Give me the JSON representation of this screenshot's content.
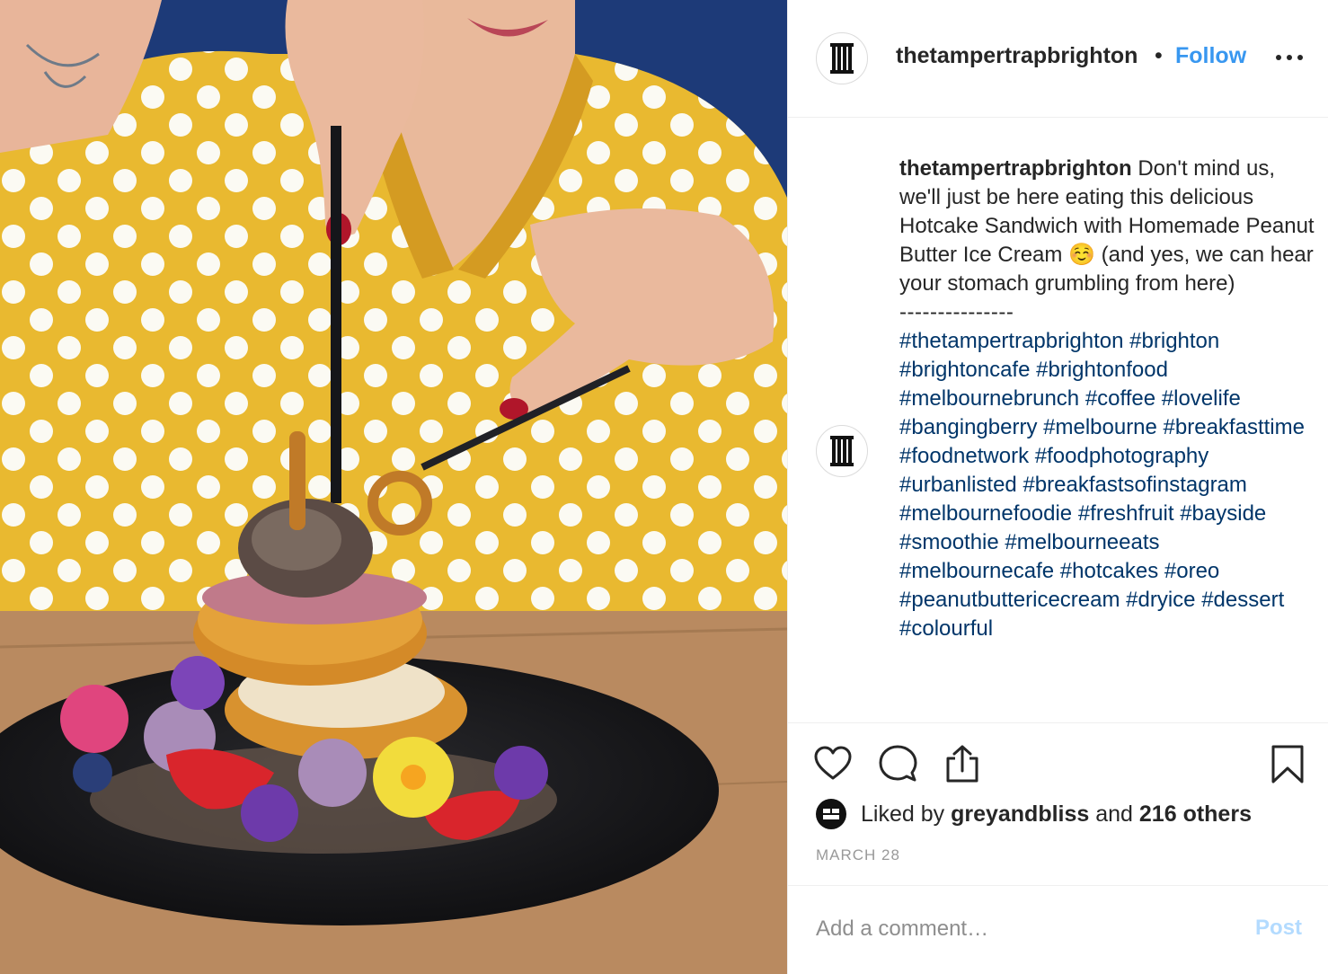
{
  "header": {
    "username": "thetampertrapbrighton",
    "dot": "•",
    "follow_label": "Follow",
    "more_icon": "ellipsis-icon"
  },
  "caption": {
    "username": "thetampertrapbrighton",
    "text_1": " Don't mind us, we'll just be here eating this delicious Hotcake Sandwich with Homemade Peanut Butter Ice Cream ",
    "emoji": "☺️",
    "text_2": " (and yes, we can hear your stomach grumbling from here)",
    "separator": "---------------",
    "hashtags": [
      "#thetampertrapbrighton",
      "#brighton",
      "#brightoncafe",
      "#brightonfood",
      "#melbournebrunch",
      "#coffee",
      "#lovelife",
      "#bangingberry",
      "#melbourne",
      "#breakfasttime",
      "#foodnetwork",
      "#foodphotography",
      "#urbanlisted",
      "#breakfastsofinstagram",
      "#melbournefoodie",
      "#freshfruit",
      "#bayside",
      "#smoothie",
      "#melbourneeats",
      "#melbournecafe",
      "#hotcakes",
      "#oreo",
      "#peanutbuttericecream",
      "#dryice",
      "#dessert",
      "#colourful"
    ]
  },
  "actions": {
    "like_icon": "heart-icon",
    "comment_icon": "comment-icon",
    "share_icon": "share-icon",
    "save_icon": "bookmark-icon"
  },
  "likes": {
    "prefix": "Liked by ",
    "user": "greyandbliss",
    "middle": " and ",
    "others": "216 others"
  },
  "date": "MARCH 28",
  "comment": {
    "placeholder": "Add a comment…",
    "post_label": "Post"
  },
  "colors": {
    "link_blue": "#3897f0",
    "hashtag": "#003569",
    "muted": "#999999",
    "post_disabled": "#b3dbff"
  }
}
